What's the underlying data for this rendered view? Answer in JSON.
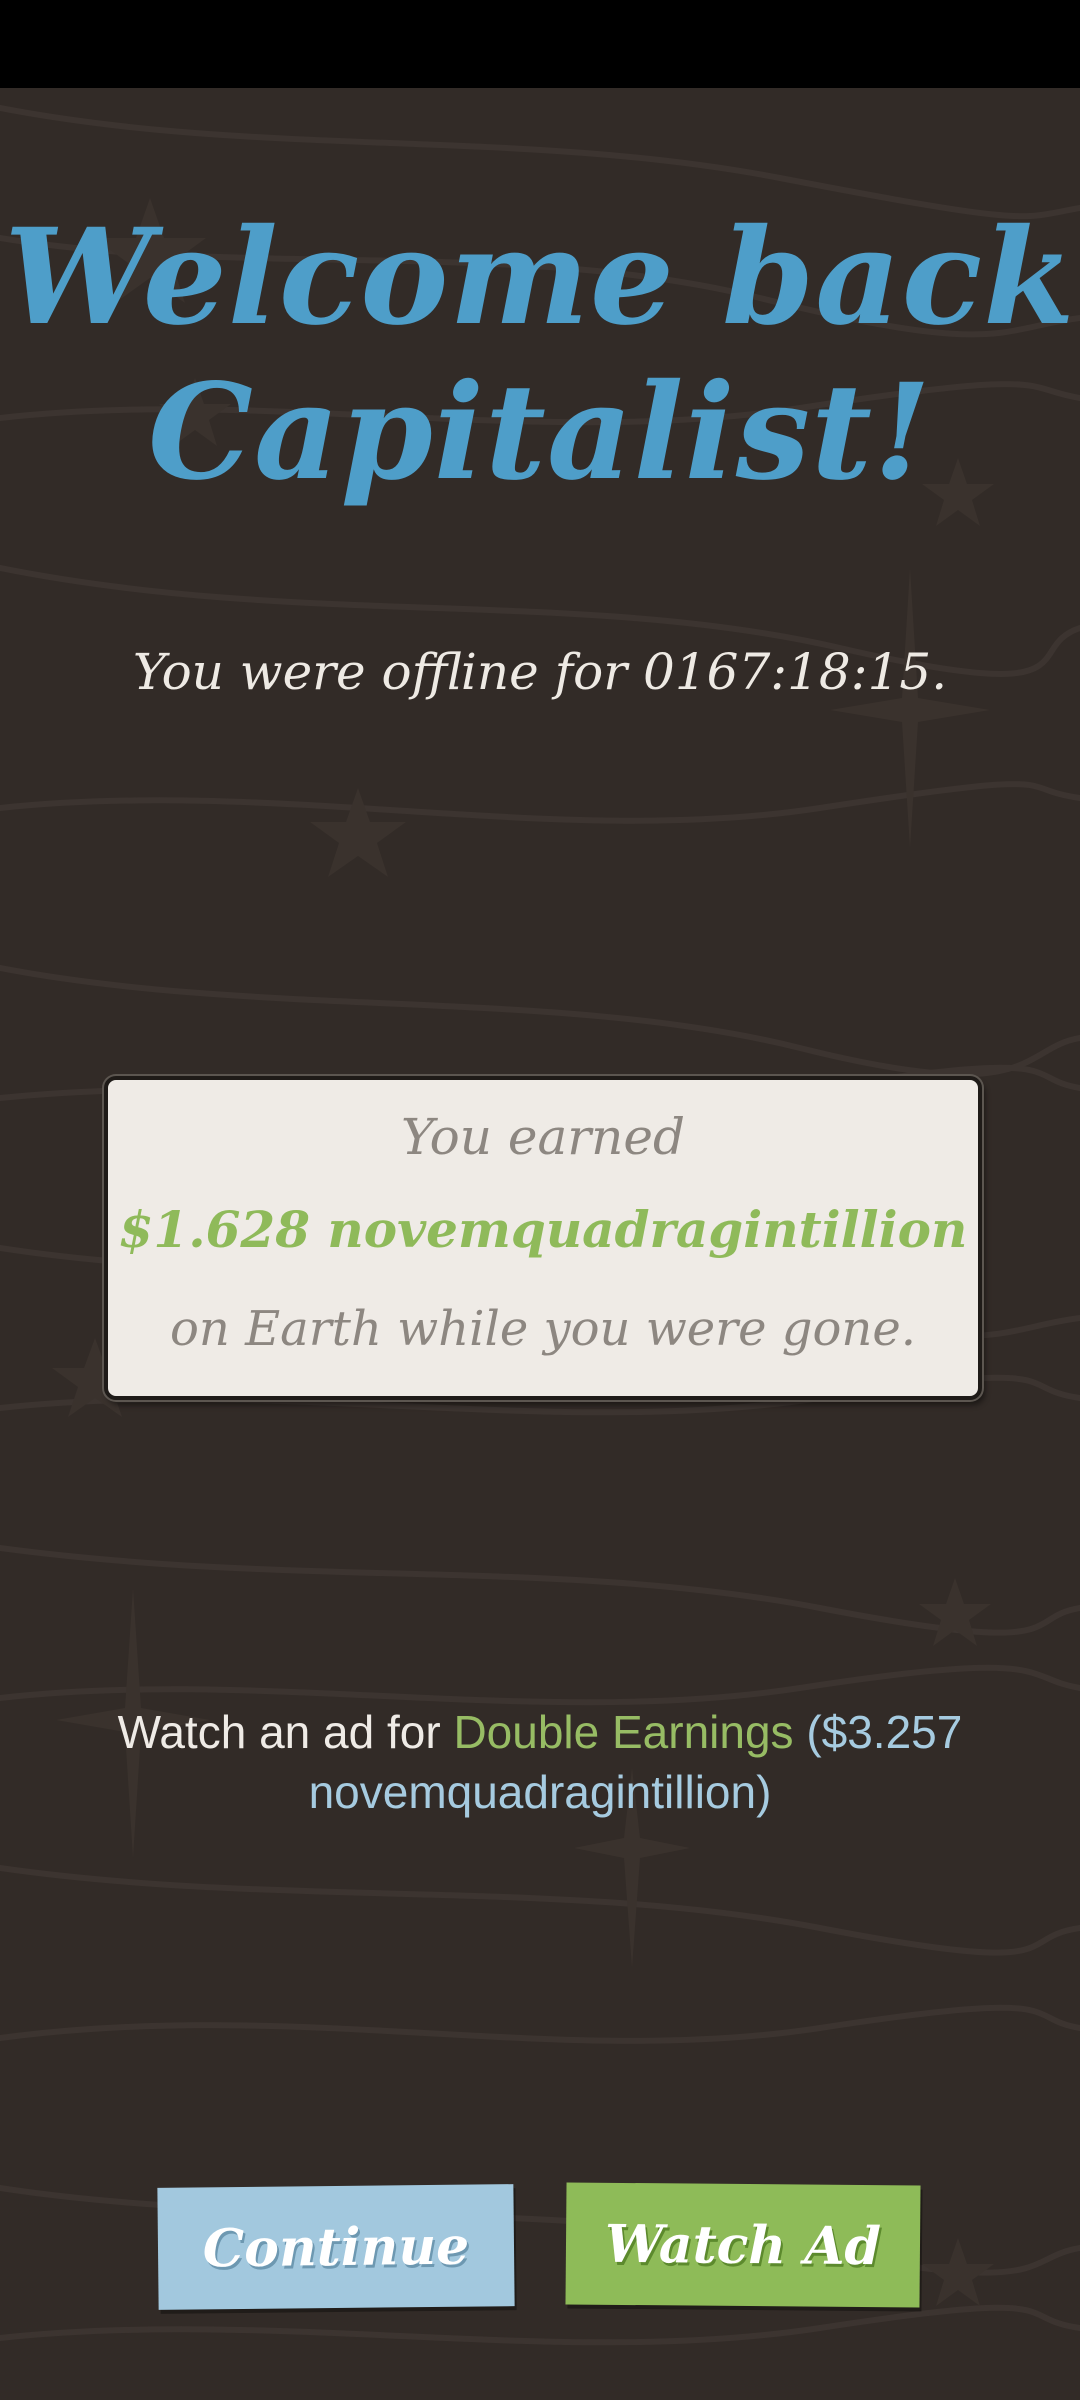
{
  "welcome": {
    "line1": "Welcome back",
    "line2": "Capitalist!"
  },
  "offline": {
    "text": "You were offline for 0167:18:15."
  },
  "earnings_card": {
    "top": "You earned",
    "amount": "$1.628 novemquadragintillion",
    "bottom": "on Earth while you were gone."
  },
  "ad_offer": {
    "prefix": "Watch an ad for ",
    "highlight": "Double Earnings",
    "amount": " ($3.257 novemquadragintillion)"
  },
  "buttons": {
    "continue": "Continue",
    "watch_ad": "Watch Ad"
  },
  "colors": {
    "background": "#322b27",
    "title": "#4e9ec9",
    "money_green": "#8fba5a",
    "continue_button": "#a2c8de",
    "watch_button": "#8ebb58"
  },
  "decorations": {
    "background_pattern": "wavy-lines",
    "star_icon": "star-icon",
    "sparkle_icon": "sparkle-icon"
  }
}
